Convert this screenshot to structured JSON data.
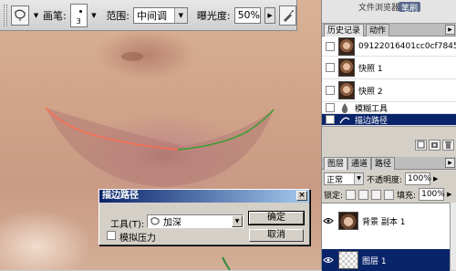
{
  "options_bar": {
    "brush_label": "画笔:",
    "brush_size": "3",
    "range_label": "范围:",
    "range_value": "中间调",
    "exposure_label": "曝光度:",
    "exposure_value": "50%"
  },
  "dock": {
    "title": "文件浏览器",
    "brushes_tab": "笔刷",
    "history_tabs": [
      "历史记录",
      "动作"
    ],
    "history_items": [
      {
        "label": "09122016401cc0cf7845...",
        "type": "snapshot"
      },
      {
        "label": "快照 1",
        "type": "snapshot"
      },
      {
        "label": "快照 2",
        "type": "snapshot"
      },
      {
        "label": "模糊工具",
        "type": "state"
      },
      {
        "label": "描边路径",
        "type": "state",
        "selected": true
      }
    ],
    "layer_tabs": [
      "图层",
      "通道",
      "路径"
    ],
    "blend_mode": "正常",
    "opacity_label": "不透明度:",
    "opacity_value": "100%",
    "lock_label": "锁定:",
    "fill_label": "填充:",
    "fill_value": "100%",
    "layers": [
      {
        "label": "背景 副本 1",
        "selected": false
      },
      {
        "label": "图层 1",
        "selected": true
      }
    ]
  },
  "dialog": {
    "title": "描边路径",
    "tool_label": "工具(T):",
    "tool_value": "加深",
    "ok_label": "确定",
    "cancel_label": "取消",
    "simulate_pressure_label": "模拟压力",
    "simulate_pressure_checked": false
  },
  "colors": {
    "selection": "#0a246a",
    "path_stroke": "#ff6a4a",
    "path_handle": "#30a030"
  }
}
